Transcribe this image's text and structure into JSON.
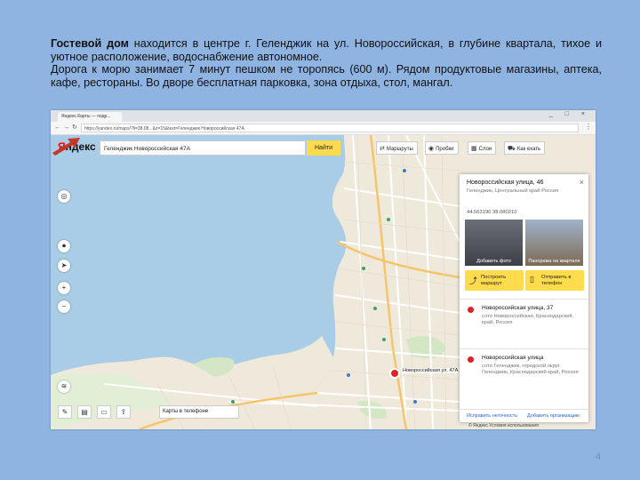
{
  "description": {
    "bold_lead": "Гостевой дом",
    "line1_rest": " находится в центре г. Геленджик на ул. Новороссийская, в глубине квартала, тихое и уютное расположение, водоснабжение автономное.",
    "line2": "Дорога к морю занимает 7 минут пешком не торопясь (600 м). Рядом продуктовые магазины, аптека, кафе, рестораны. Во дворе бесплатная парковка, зона отдыха, стол, мангал."
  },
  "page_number": "4",
  "browser": {
    "tab_title": "Яндекс.Карты — подр...",
    "url": "https://yandex.ru/maps/?ll=38.08...&z=15&text=Геленджик Новороссийская 47А",
    "window_controls": "_ □ ×"
  },
  "map_ui": {
    "logo_ya": "Я",
    "logo_rest": "ндекс",
    "search_value": "Геленджик Новороссийская 47А",
    "find_label": "Найти",
    "tools": [
      {
        "label": "Маршруты",
        "icon": "route-icon",
        "glyph": "⇄"
      },
      {
        "label": "Пробки",
        "icon": "traffic-icon",
        "glyph": "◉"
      },
      {
        "label": "Слои",
        "icon": "layers-icon",
        "glyph": "▦"
      },
      {
        "label": "Как ехать",
        "icon": "car-icon",
        "glyph": "⛟"
      }
    ],
    "left_controls": [
      {
        "name": "panorama-icon",
        "glyph": "◎"
      },
      {
        "name": "traffic-light-icon",
        "glyph": "⏺"
      },
      {
        "name": "locate-icon",
        "glyph": "➤"
      },
      {
        "name": "zoom-in-icon",
        "glyph": "+"
      },
      {
        "name": "zoom-out-icon",
        "glyph": "−"
      },
      {
        "name": "layers-stack-icon",
        "glyph": "≋"
      }
    ],
    "bottom_controls": [
      {
        "name": "ruler-icon",
        "glyph": "✎"
      },
      {
        "name": "print-icon",
        "glyph": "▤"
      },
      {
        "name": "bus-icon",
        "glyph": "▭"
      },
      {
        "name": "share-icon",
        "glyph": "⇪"
      }
    ],
    "phone_label": "Карты в телефоне",
    "marker_label": "Новороссийская ул. 47А"
  },
  "panel": {
    "title": "Новороссийская улица, 46",
    "subtitle": "Геленджик, Центральный край Россия",
    "coords": "44.563190 38.080210",
    "photo_left_caption": "Добавить фото",
    "photo_right_caption": "Панорама на квартале",
    "btn_route": "Построить маршрут",
    "btn_send": "Отправить в телефон",
    "results": [
      {
        "title": "Новороссийская улица, 37",
        "desc": "сото Новороссийская, Краснодарский край, Россия"
      },
      {
        "title": "Новороссийская улица",
        "desc": "сото Геленджик, городской округ Геленджик, Краснодарский край, Россия"
      }
    ],
    "foot_left": "Исправить неточность",
    "foot_right": "Добавить организацию"
  },
  "attribution": "© Яндекс Условия использования"
}
